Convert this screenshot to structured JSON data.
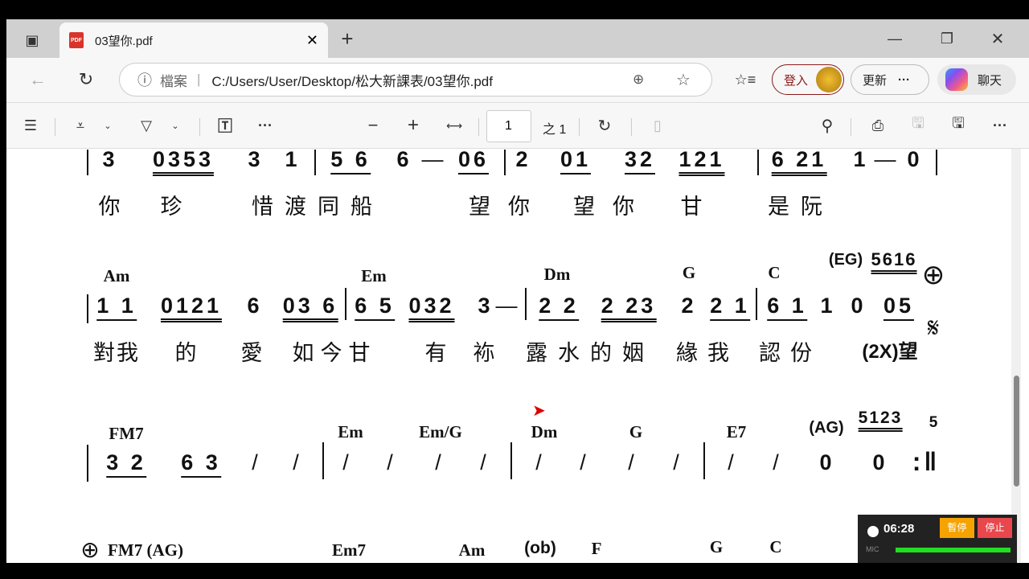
{
  "browser": {
    "tab_title": "03望你.pdf",
    "tab_icon": "PDF",
    "address_label": "檔案",
    "url": "C:/Users/User/Desktop/松大新課表/03望你.pdf",
    "signin": "登入",
    "update": "更新",
    "chat": "聊天"
  },
  "toolbar": {
    "page_current": "1",
    "page_total": "之 1"
  },
  "sheet": {
    "row1": {
      "notes": [
        "3",
        "0353",
        "3",
        "1",
        "5 6",
        "6",
        "—",
        "06",
        "2",
        "01",
        "32",
        "121",
        "6 21",
        "1",
        "—",
        "0"
      ],
      "lyrics": [
        "你",
        "珍",
        "惜渡同船",
        "望你",
        "望你",
        "甘",
        "是阮"
      ]
    },
    "row2": {
      "chords": [
        "Am",
        "Em",
        "Dm",
        "G",
        "C",
        "(EG)",
        "5616"
      ],
      "notes": [
        "1 1",
        "0121",
        "6",
        "03 6",
        "6 5",
        "032",
        "3",
        "—",
        "2 2",
        "2 23",
        "2",
        "2 1",
        "6 1",
        "1",
        "0",
        "05"
      ],
      "lyrics": [
        "對我",
        "的",
        "愛",
        "如今甘",
        "有",
        "袮",
        "露水的姻",
        "緣我",
        "認份",
        "(2X)望"
      ],
      "coda": "⊕",
      "segno": "𝄋"
    },
    "row3": {
      "chords": [
        "FM7",
        "Em",
        "Em/G",
        "Dm",
        "G",
        "E7",
        "(AG)",
        "5123",
        "5"
      ],
      "notes": [
        "3 2",
        "6 3",
        "/",
        "/",
        "/",
        "/",
        "/",
        "/",
        "/",
        "/",
        "/",
        "/",
        "/",
        "/",
        "0",
        "0",
        ":‖"
      ]
    },
    "row4": {
      "coda": "⊕",
      "chords": [
        "FM7 (AG)",
        "Em7",
        "Am",
        "(ob)",
        "F",
        "G",
        "C"
      ]
    }
  },
  "recorder": {
    "time": "06:28",
    "pause": "暫停",
    "stop": "停止",
    "mic_label": "MIC",
    "mic_level": 1.0,
    "colors": {
      "pause": "#f5a300",
      "stop": "#e8474c",
      "level": "#22dd22"
    }
  }
}
